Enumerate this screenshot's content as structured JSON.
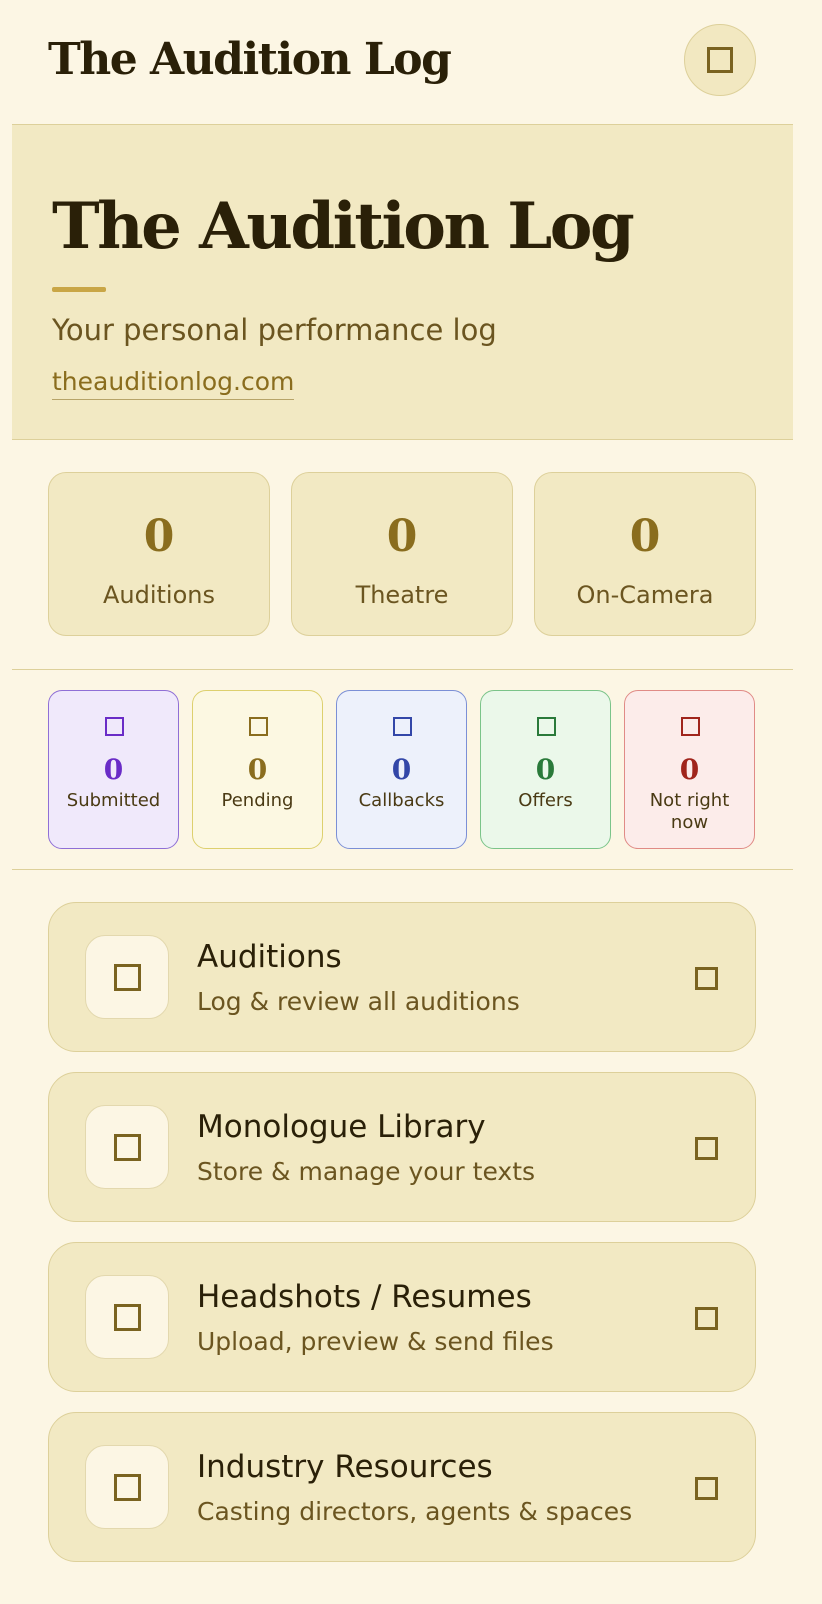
{
  "header": {
    "app_title": "The Audition Log",
    "menu_icon": "square-icon"
  },
  "hero": {
    "title": "The Audition Log",
    "tagline": "Your personal performance log",
    "link": "theauditionlog.com"
  },
  "categories": [
    {
      "value": "0",
      "label": "Auditions"
    },
    {
      "value": "0",
      "label": "Theatre"
    },
    {
      "value": "0",
      "label": "On-Camera"
    }
  ],
  "statuses": [
    {
      "value": "0",
      "label": "Submitted",
      "color": "#6a2cc7",
      "bg": "#f0e9fb",
      "border": "#8f6fd6"
    },
    {
      "value": "0",
      "label": "Pending",
      "color": "#8a6d1e",
      "bg": "#fcf8e2",
      "border": "#ddd06e"
    },
    {
      "value": "0",
      "label": "Callbacks",
      "color": "#3347a8",
      "bg": "#edf1fb",
      "border": "#7b8fd6"
    },
    {
      "value": "0",
      "label": "Offers",
      "color": "#2a7a3a",
      "bg": "#ebf8ea",
      "border": "#7bc489"
    },
    {
      "value": "0",
      "label": "Not right now",
      "color": "#a0251c",
      "bg": "#fcecea",
      "border": "#e08b86"
    }
  ],
  "nav": [
    {
      "title": "Auditions",
      "subtitle": "Log & review all auditions"
    },
    {
      "title": "Monologue Library",
      "subtitle": "Store & manage your texts"
    },
    {
      "title": "Headshots / Resumes",
      "subtitle": "Upload, preview & send files"
    },
    {
      "title": "Industry Resources",
      "subtitle": "Casting directors, agents & spaces"
    }
  ]
}
